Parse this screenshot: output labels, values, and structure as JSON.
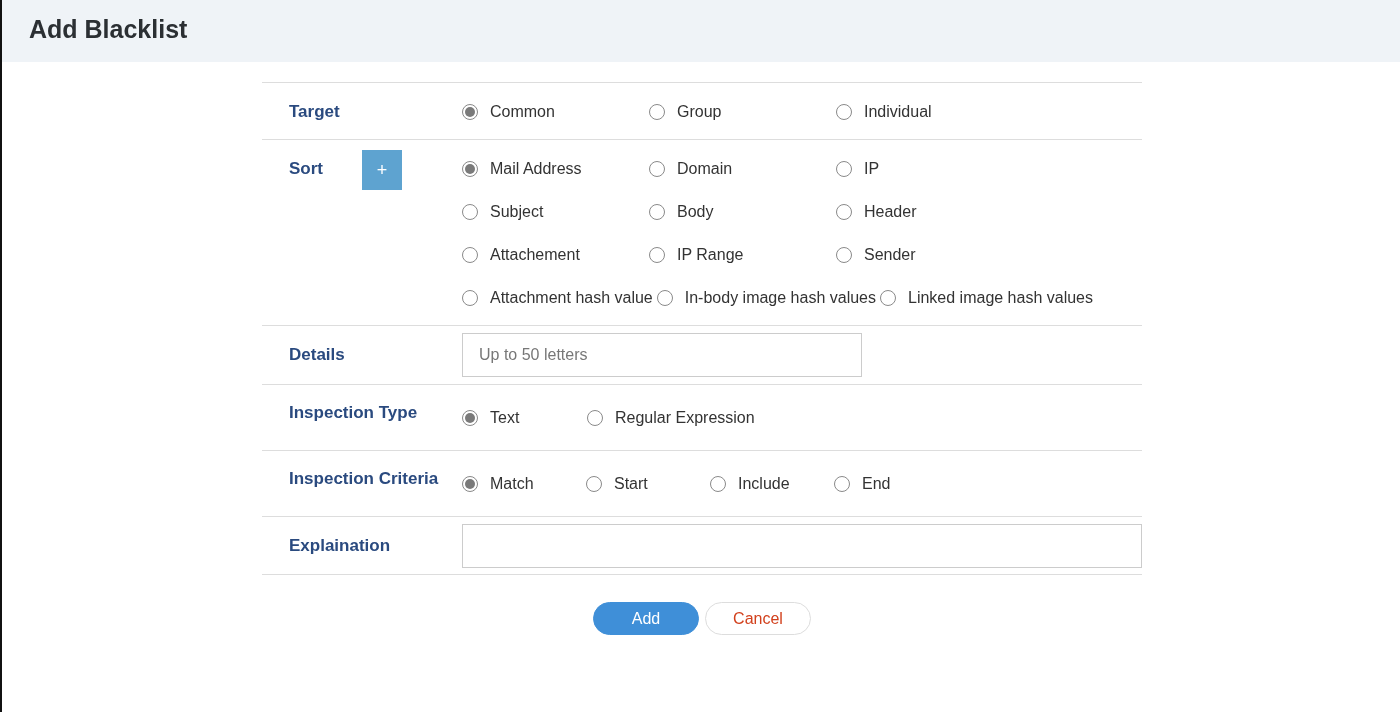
{
  "title": "Add Blacklist",
  "rows": [
    {
      "kind": "radio",
      "label": "Target",
      "options": [
        {
          "label": "Common",
          "selected": true
        },
        {
          "label": "Group",
          "selected": false
        },
        {
          "label": "Individual",
          "selected": false
        }
      ]
    },
    {
      "kind": "radio",
      "label": "Sort",
      "add_button": "+",
      "options": [
        {
          "label": "Mail Address",
          "selected": true
        },
        {
          "label": "Domain",
          "selected": false
        },
        {
          "label": "IP",
          "selected": false
        },
        {
          "label": "Subject",
          "selected": false
        },
        {
          "label": "Body",
          "selected": false
        },
        {
          "label": "Header",
          "selected": false
        },
        {
          "label": "Attachement",
          "selected": false
        },
        {
          "label": "IP Range",
          "selected": false
        },
        {
          "label": "Sender",
          "selected": false
        },
        {
          "label": "Attachment hash value",
          "selected": false
        },
        {
          "label": "In-body image hash values",
          "selected": false
        },
        {
          "label": "Linked image hash values",
          "selected": false
        }
      ]
    },
    {
      "kind": "text",
      "label": "Details",
      "placeholder": "Up to 50 letters"
    },
    {
      "kind": "radio",
      "label": "Inspection Type",
      "options": [
        {
          "label": "Text",
          "selected": true
        },
        {
          "label": "Regular Expression",
          "selected": false
        }
      ]
    },
    {
      "kind": "radio",
      "label": "Inspection Criteria",
      "options": [
        {
          "label": "Match",
          "selected": true
        },
        {
          "label": "Start",
          "selected": false
        },
        {
          "label": "Include",
          "selected": false
        },
        {
          "label": "End",
          "selected": false
        }
      ]
    },
    {
      "kind": "textarea",
      "label": "Explaination"
    }
  ],
  "buttons": [
    {
      "label": "Add",
      "kind": "primary"
    },
    {
      "label": "Cancel",
      "kind": "secondary"
    }
  ]
}
